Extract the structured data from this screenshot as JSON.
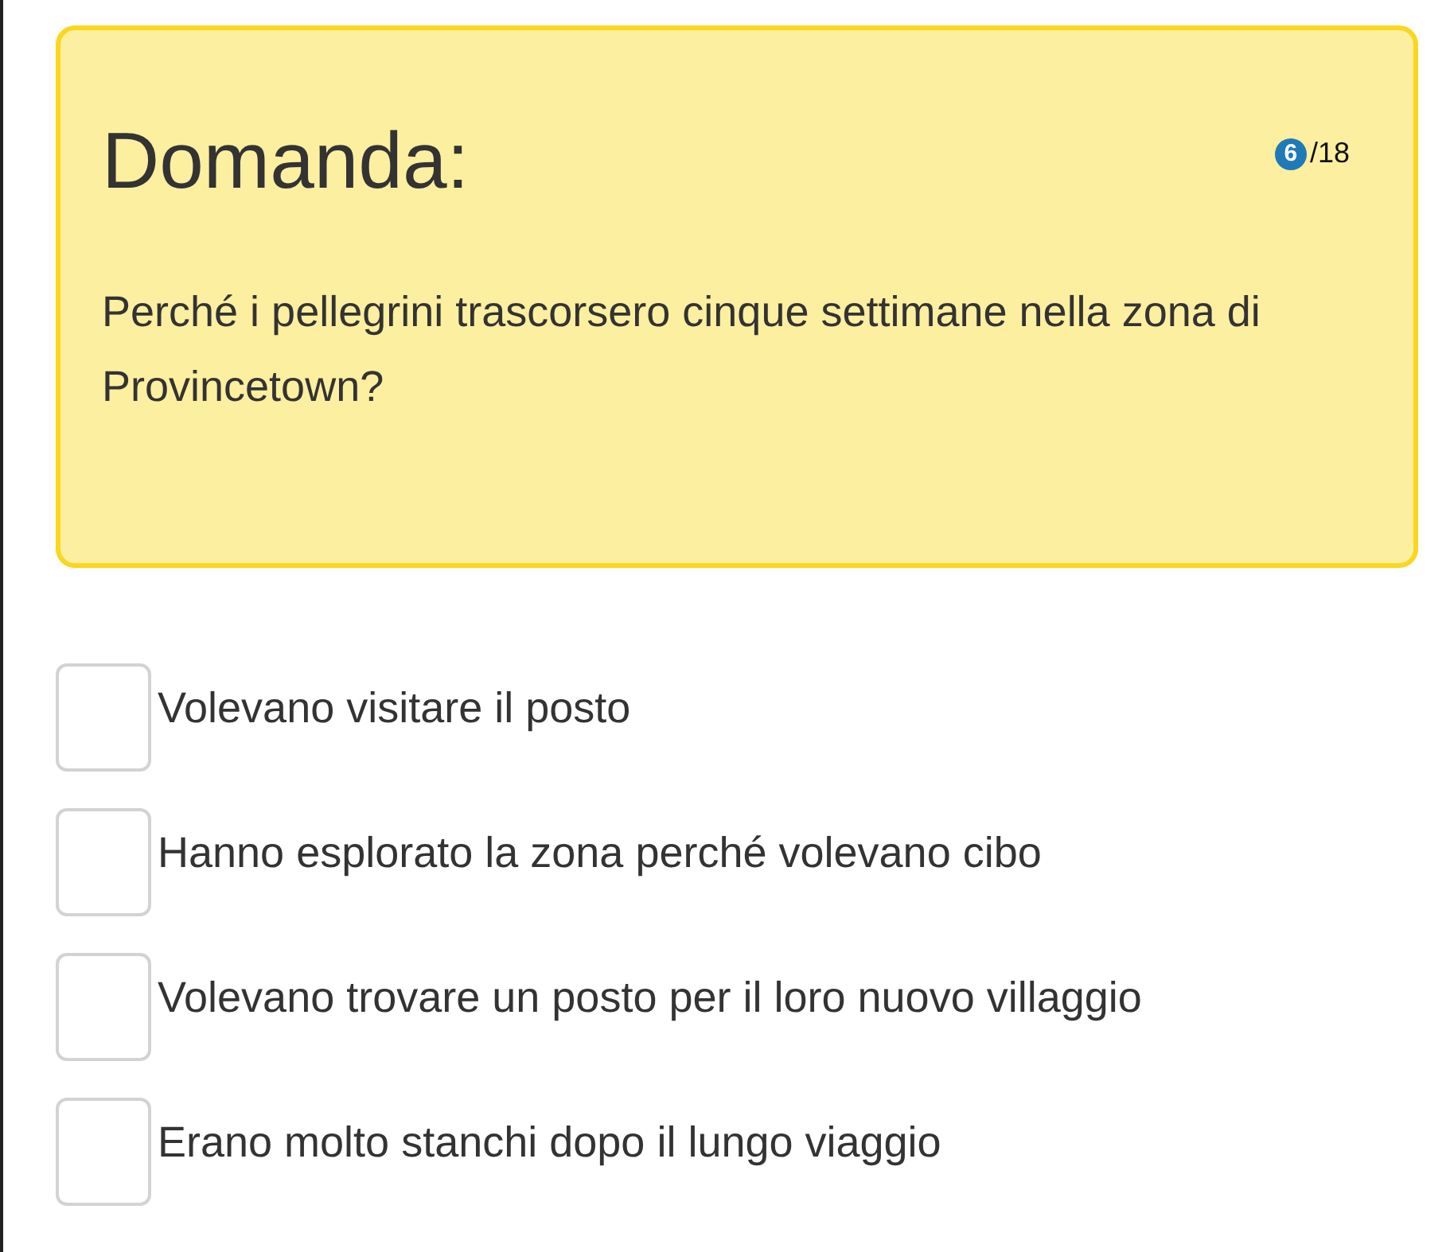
{
  "question": {
    "title": "Domanda:",
    "counter": {
      "current": "6",
      "total": "/18"
    },
    "text": "Perché i pellegrini trascorsero cinque settimane nella zona di Provincetown?"
  },
  "options": [
    {
      "label": "Volevano visitare il posto",
      "checked": false
    },
    {
      "label": "Hanno esplorato la zona perché volevano cibo",
      "checked": false
    },
    {
      "label": "Volevano trovare un posto per il loro nuovo villaggio",
      "checked": false
    },
    {
      "label": "Erano molto stanchi dopo il lungo viaggio",
      "checked": false
    }
  ]
}
